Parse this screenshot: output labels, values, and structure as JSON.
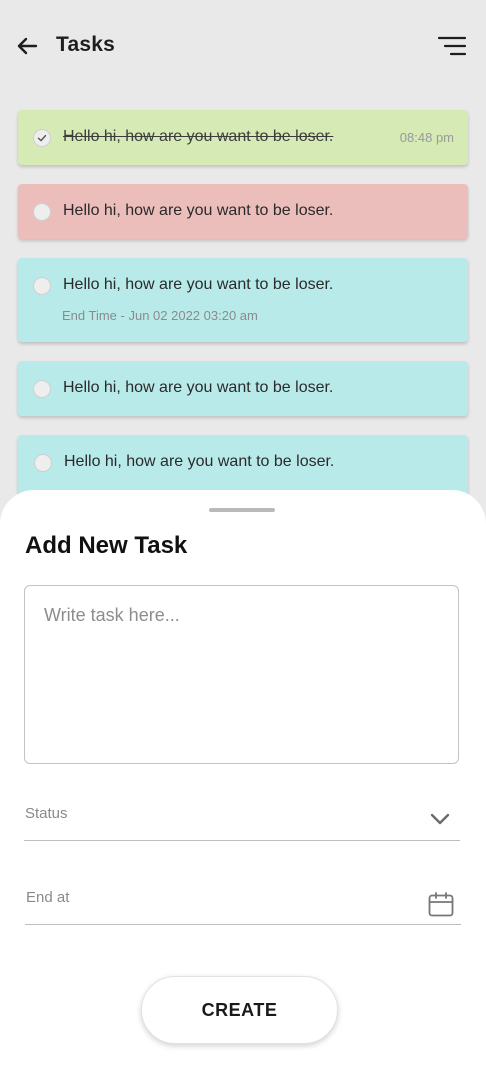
{
  "header": {
    "title": "Tasks",
    "back_icon": "arrow-left-icon",
    "menu_icon": "menu-icon"
  },
  "tasks": [
    {
      "text": "Hello hi, how are you want to be loser.",
      "time": "08:48 pm",
      "completed": true,
      "color": "#d5eab4"
    },
    {
      "text": "Hello hi, how are you want to be loser.",
      "completed": false,
      "color": "#ebbebc"
    },
    {
      "text": "Hello hi, how are you want to be loser.",
      "end_time": "End Time - Jun 02 2022 03:20 am",
      "completed": false,
      "color": "#b9eaea"
    },
    {
      "text": "Hello hi, how are you want to be loser.",
      "completed": false,
      "color": "#b9eaea"
    },
    {
      "text": "Hello hi, how are you want to be loser.",
      "completed": false,
      "color": "#b9eaea"
    }
  ],
  "sheet": {
    "title": "Add New Task",
    "task_placeholder": "Write task here...",
    "status_label": "Status",
    "status_icon": "chevron-down-icon",
    "end_label": "End at",
    "end_icon": "calendar-icon",
    "create_label": "CREATE"
  }
}
